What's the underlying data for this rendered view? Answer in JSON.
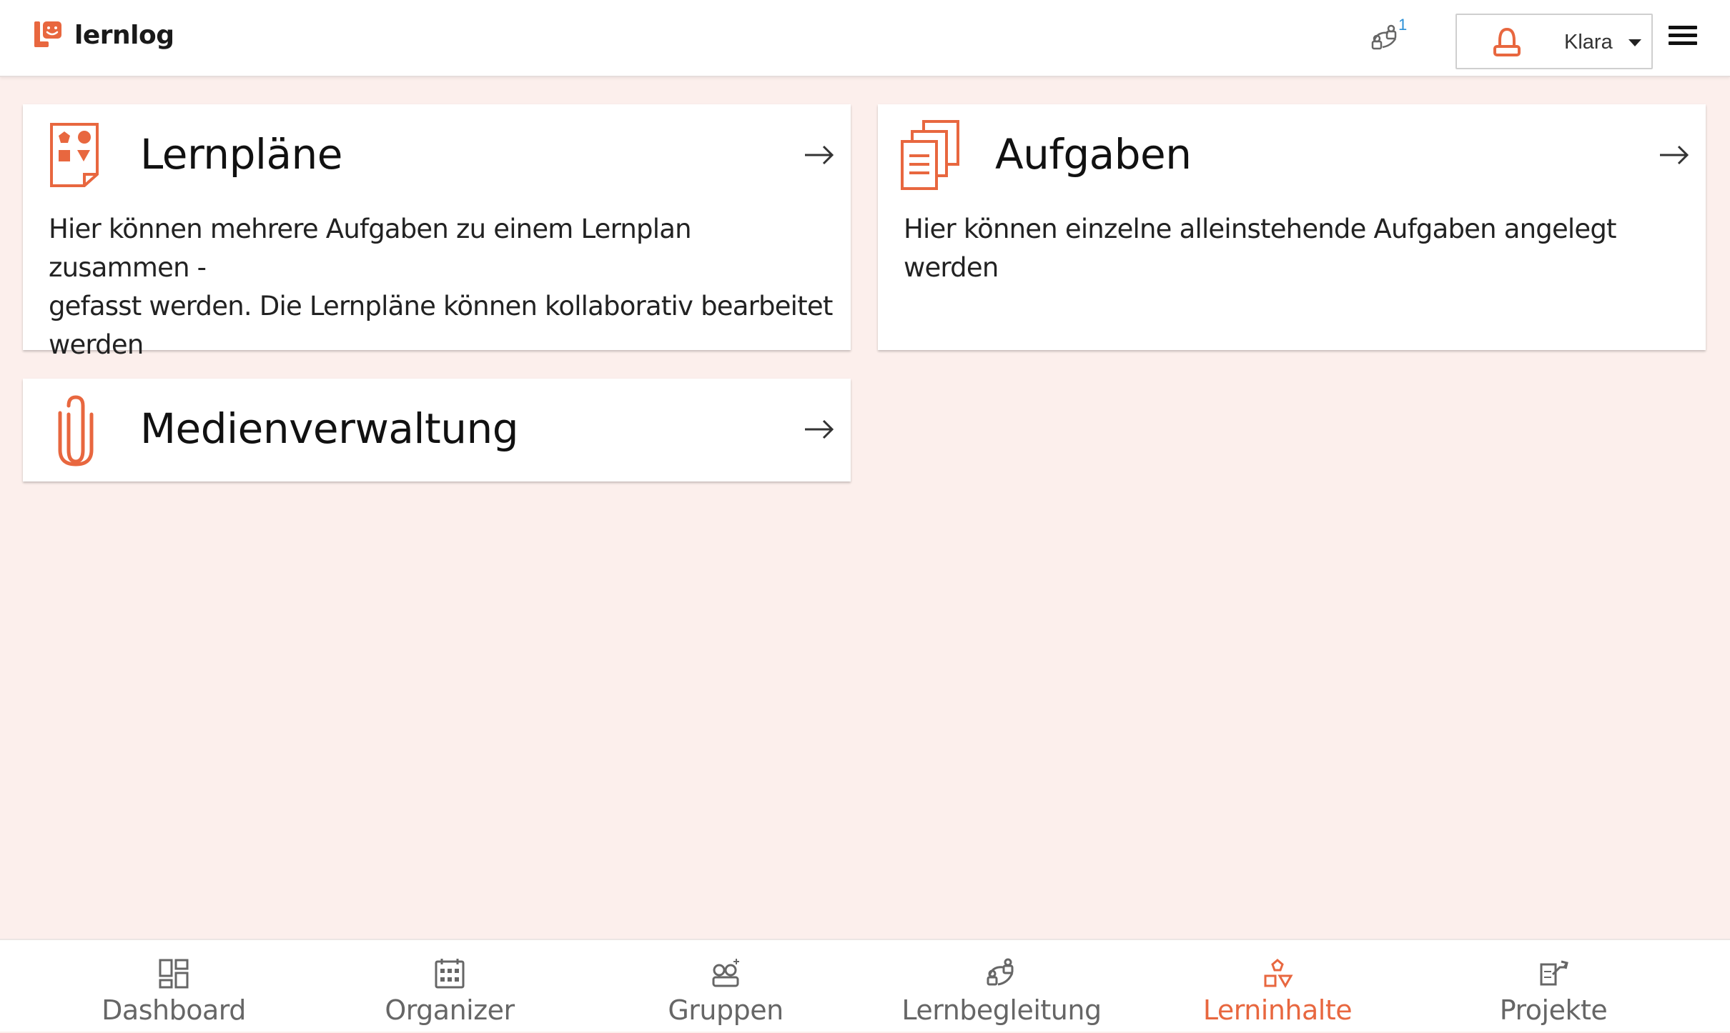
{
  "app": {
    "name": "lernlog"
  },
  "header": {
    "notification_count": "1",
    "user_name": "Klara"
  },
  "cards": [
    {
      "title": "Lernpläne",
      "description_lines": [
        "Hier können mehrere Aufgaben zu einem Lernplan zusammen -",
        "gefasst werden. Die Lernpläne können kollaborativ bearbeitet",
        "werden"
      ]
    },
    {
      "title": "Aufgaben",
      "description_lines": [
        "Hier können einzelne alleinstehende Aufgaben angelegt werden"
      ]
    },
    {
      "title": "Medienverwaltung",
      "description_lines": []
    }
  ],
  "bottom_nav": [
    {
      "label": "Dashboard",
      "icon": "dashboard-icon",
      "active": false
    },
    {
      "label": "Organizer",
      "icon": "calendar-icon",
      "active": false
    },
    {
      "label": "Gruppen",
      "icon": "group-icon",
      "active": false
    },
    {
      "label": "Lernbegleitung",
      "icon": "mentoring-icon",
      "active": false
    },
    {
      "label": "Lerninhalte",
      "icon": "shapes-icon",
      "active": true
    },
    {
      "label": "Projekte",
      "icon": "project-icon",
      "active": false
    }
  ],
  "colors": {
    "accent": "#e8673f",
    "background": "#fcefec",
    "notification": "#2a8fd6"
  }
}
